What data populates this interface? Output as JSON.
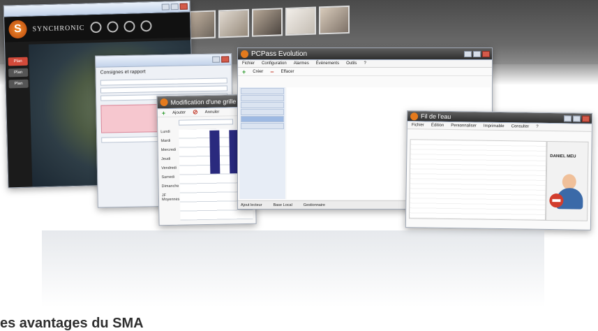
{
  "synchronic": {
    "logo_text": "SYNCHRONIC",
    "nav_buttons": [
      "Plan",
      "Plan",
      "Plan"
    ]
  },
  "contacts_window": {
    "title": "Consignes et rapport"
  },
  "grid_window": {
    "title": "Modification d'une grille",
    "toolbar": [
      "Ajouter",
      "Annuler"
    ],
    "days": [
      "Lundi",
      "Mardi",
      "Mercredi",
      "Jeudi",
      "Vendredi",
      "Samedi",
      "Dimanche",
      "JF Moyennes"
    ]
  },
  "pcpass": {
    "title": "PCPass Evolution",
    "menu": [
      "Fichier",
      "Configuration",
      "Alarmes",
      "Évènements",
      "Outils",
      "?"
    ],
    "toolbar": [
      "Créer",
      "Effacer"
    ],
    "status": [
      "Ajout lecteur",
      "Base Local",
      "Gestionnaire"
    ]
  },
  "fil_window": {
    "title": "Fil de l'eau",
    "menu": [
      "Fichier",
      "Édition",
      "Personnaliser",
      "Imprimable",
      "Consulter",
      "?"
    ],
    "card_name": "DANIEL MEU"
  },
  "heading": "es avantages du SMA"
}
